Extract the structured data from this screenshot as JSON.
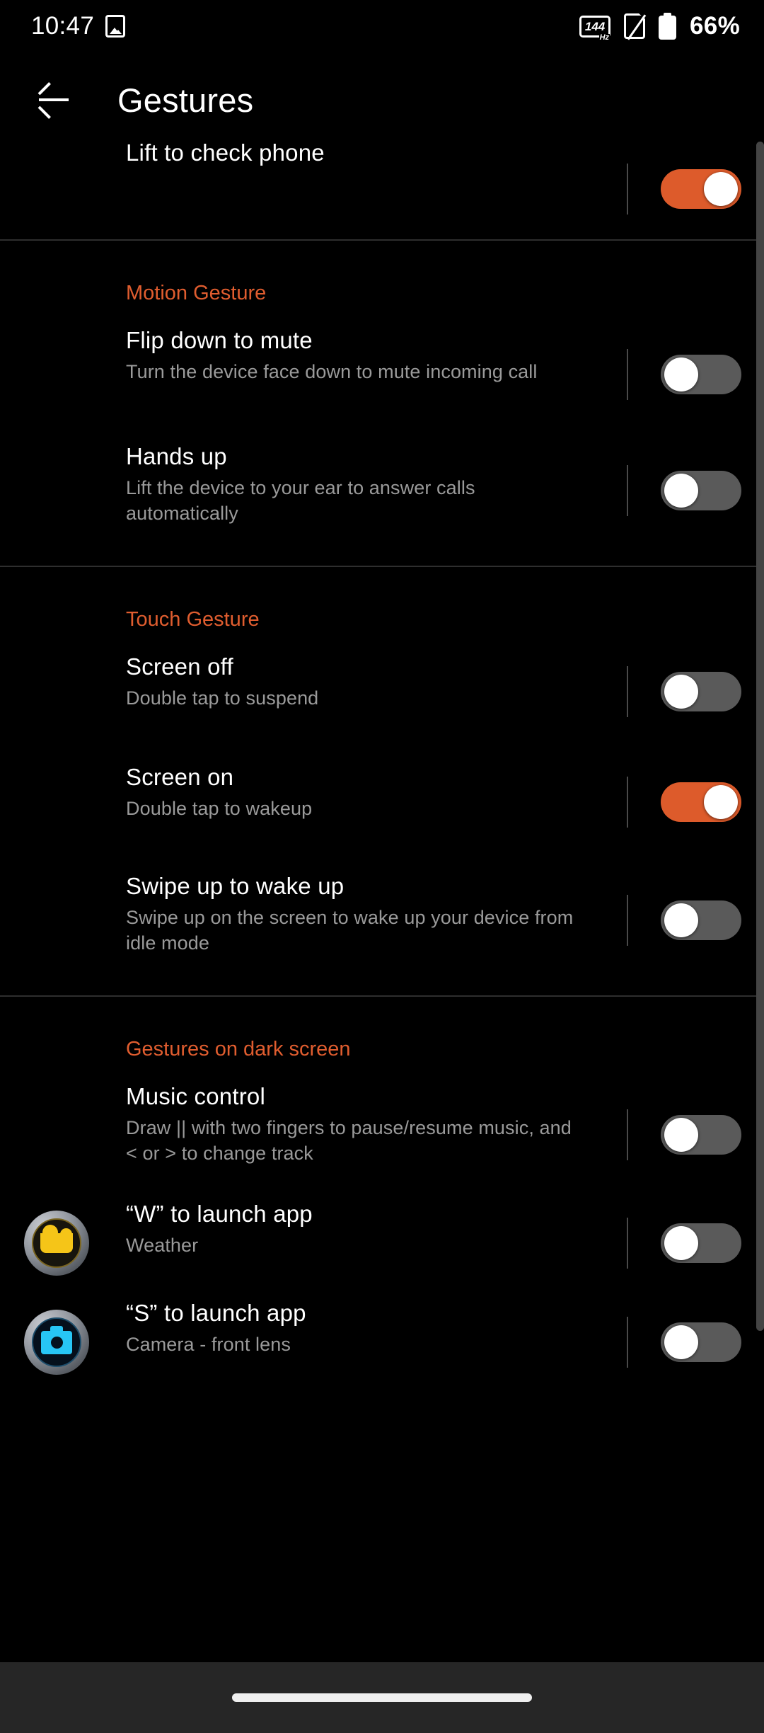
{
  "status_bar": {
    "time": "10:47",
    "screenshot_icon": "screenshot-icon",
    "refresh_rate": "144",
    "refresh_unit": "Hz",
    "sim_icon": "no-sim-icon",
    "battery_icon": "battery-icon",
    "battery_percent": "66%"
  },
  "header": {
    "back_icon": "back-arrow-icon",
    "title": "Gestures"
  },
  "sections": [
    {
      "header": null,
      "rows": [
        {
          "title": "Lift to check phone",
          "subtitle": null,
          "toggle": "on",
          "icon": null
        }
      ]
    },
    {
      "header": "Motion Gesture",
      "rows": [
        {
          "title": "Flip down to mute",
          "subtitle": "Turn the device face down to mute incoming call",
          "toggle": "off",
          "icon": null
        },
        {
          "title": "Hands up",
          "subtitle": "Lift the device to your ear to answer calls automatically",
          "toggle": "off",
          "icon": null
        }
      ]
    },
    {
      "header": "Touch Gesture",
      "rows": [
        {
          "title": "Screen off",
          "subtitle": "Double tap to suspend",
          "toggle": "off",
          "icon": null
        },
        {
          "title": "Screen on",
          "subtitle": "Double tap to wakeup",
          "toggle": "on",
          "icon": null
        },
        {
          "title": "Swipe up to wake up",
          "subtitle": "Swipe up on the screen to wake up your device from idle mode",
          "toggle": "off",
          "icon": null
        }
      ]
    },
    {
      "header": "Gestures on dark screen",
      "rows": [
        {
          "title": "Music control",
          "subtitle": "Draw || with two fingers to pause/resume music, and < or > to change track",
          "toggle": "off",
          "icon": null
        },
        {
          "title": "“W” to launch app",
          "subtitle": "Weather",
          "toggle": "off",
          "icon": "weather-app-icon"
        },
        {
          "title": "“S” to launch app",
          "subtitle": "Camera - front lens",
          "toggle": "off",
          "icon": "camera-app-icon"
        }
      ]
    }
  ],
  "nav_bar": {
    "gesture_pill": "home-gesture-pill"
  },
  "colors": {
    "background": "#000000",
    "accent": "#E05D2F",
    "toggle_on": "#DD5B2B",
    "toggle_off": "#5A5A5A",
    "title_text": "#FFFFFF",
    "subtitle_text": "#9A9A9A",
    "divider": "#2E2E2E",
    "nav_bar": "#262626"
  }
}
